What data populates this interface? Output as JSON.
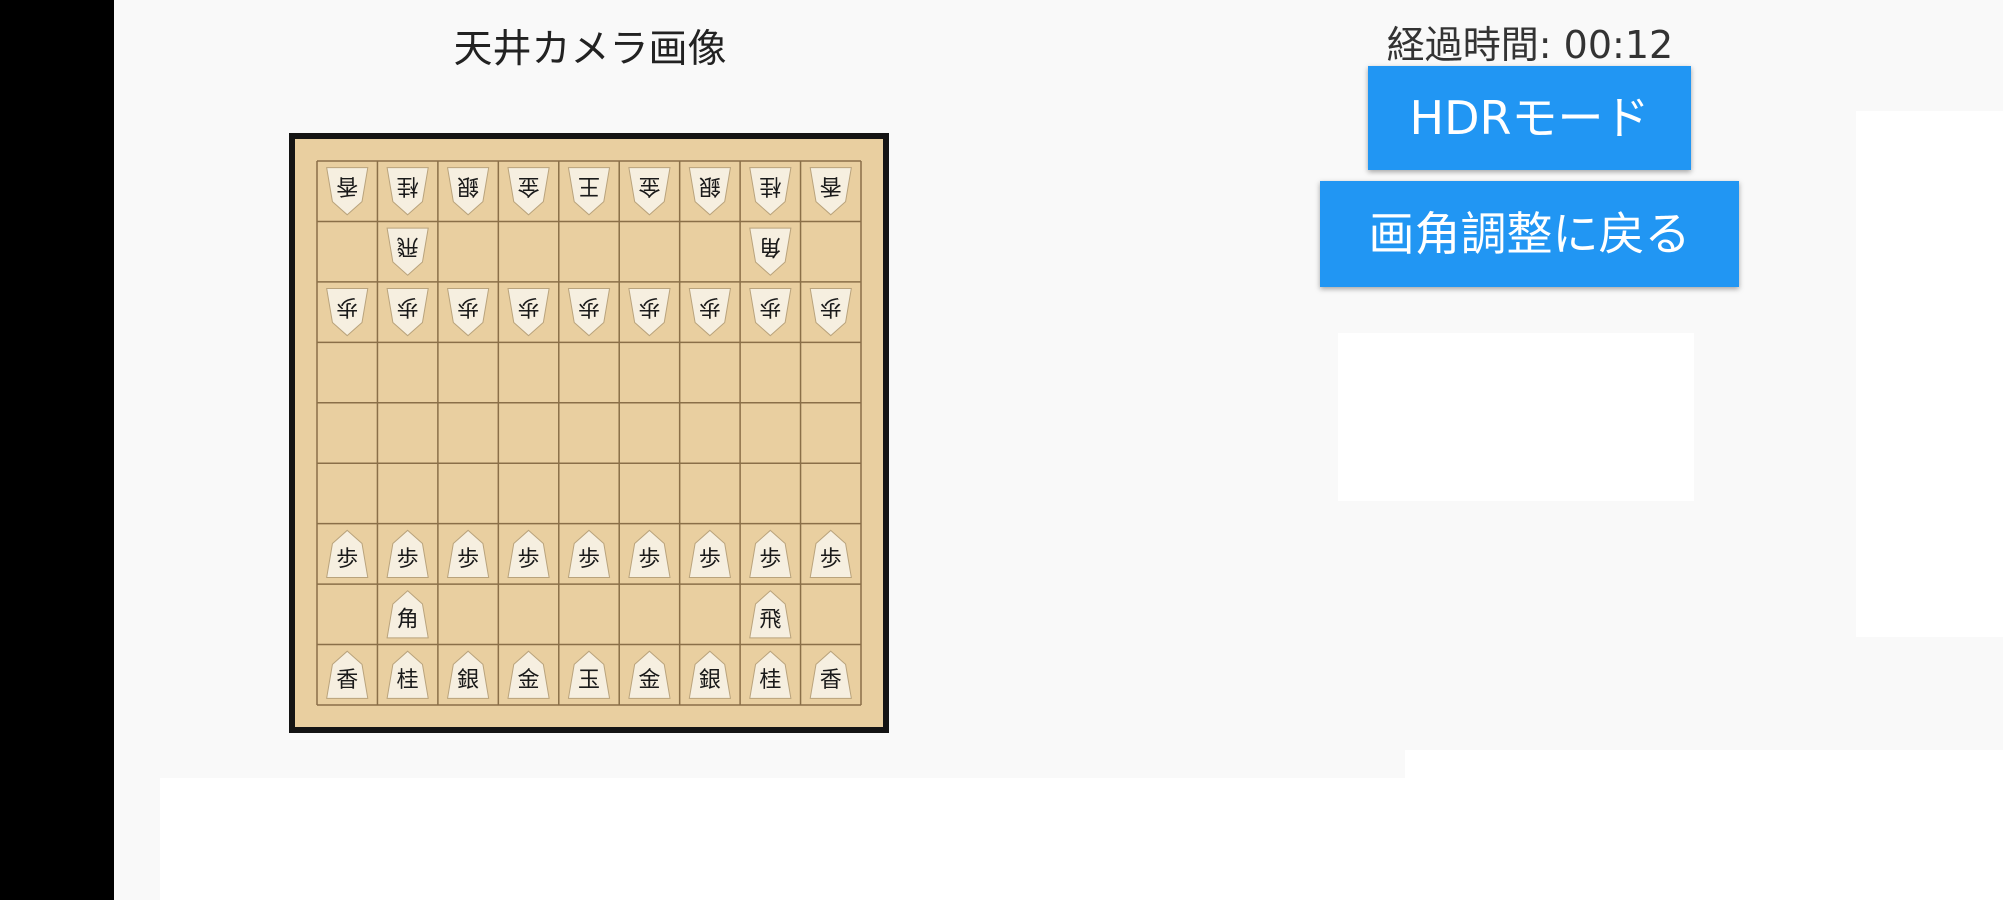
{
  "camera": {
    "title": "天井カメラ画像"
  },
  "timer": {
    "elapsed_label": "経過時間: 00:12"
  },
  "buttons": {
    "hdr_label": "HDRモード",
    "back_label": "画角調整に戻る"
  },
  "board": {
    "files": 9,
    "ranks": 9,
    "pieces": [
      {
        "rank": 1,
        "file": 1,
        "piece": "香",
        "side": "gote"
      },
      {
        "rank": 1,
        "file": 2,
        "piece": "桂",
        "side": "gote"
      },
      {
        "rank": 1,
        "file": 3,
        "piece": "銀",
        "side": "gote"
      },
      {
        "rank": 1,
        "file": 4,
        "piece": "金",
        "side": "gote"
      },
      {
        "rank": 1,
        "file": 5,
        "piece": "王",
        "side": "gote"
      },
      {
        "rank": 1,
        "file": 6,
        "piece": "金",
        "side": "gote"
      },
      {
        "rank": 1,
        "file": 7,
        "piece": "銀",
        "side": "gote"
      },
      {
        "rank": 1,
        "file": 8,
        "piece": "桂",
        "side": "gote"
      },
      {
        "rank": 1,
        "file": 9,
        "piece": "香",
        "side": "gote"
      },
      {
        "rank": 2,
        "file": 2,
        "piece": "飛",
        "side": "gote"
      },
      {
        "rank": 2,
        "file": 8,
        "piece": "角",
        "side": "gote"
      },
      {
        "rank": 3,
        "file": 1,
        "piece": "歩",
        "side": "gote"
      },
      {
        "rank": 3,
        "file": 2,
        "piece": "歩",
        "side": "gote"
      },
      {
        "rank": 3,
        "file": 3,
        "piece": "歩",
        "side": "gote"
      },
      {
        "rank": 3,
        "file": 4,
        "piece": "歩",
        "side": "gote"
      },
      {
        "rank": 3,
        "file": 5,
        "piece": "歩",
        "side": "gote"
      },
      {
        "rank": 3,
        "file": 6,
        "piece": "歩",
        "side": "gote"
      },
      {
        "rank": 3,
        "file": 7,
        "piece": "歩",
        "side": "gote"
      },
      {
        "rank": 3,
        "file": 8,
        "piece": "歩",
        "side": "gote"
      },
      {
        "rank": 3,
        "file": 9,
        "piece": "歩",
        "side": "gote"
      },
      {
        "rank": 7,
        "file": 1,
        "piece": "歩",
        "side": "sente"
      },
      {
        "rank": 7,
        "file": 2,
        "piece": "歩",
        "side": "sente"
      },
      {
        "rank": 7,
        "file": 3,
        "piece": "歩",
        "side": "sente"
      },
      {
        "rank": 7,
        "file": 4,
        "piece": "歩",
        "side": "sente"
      },
      {
        "rank": 7,
        "file": 5,
        "piece": "歩",
        "side": "sente"
      },
      {
        "rank": 7,
        "file": 6,
        "piece": "歩",
        "side": "sente"
      },
      {
        "rank": 7,
        "file": 7,
        "piece": "歩",
        "side": "sente"
      },
      {
        "rank": 7,
        "file": 8,
        "piece": "歩",
        "side": "sente"
      },
      {
        "rank": 7,
        "file": 9,
        "piece": "歩",
        "side": "sente"
      },
      {
        "rank": 8,
        "file": 2,
        "piece": "角",
        "side": "sente"
      },
      {
        "rank": 8,
        "file": 8,
        "piece": "飛",
        "side": "sente"
      },
      {
        "rank": 9,
        "file": 1,
        "piece": "香",
        "side": "sente"
      },
      {
        "rank": 9,
        "file": 2,
        "piece": "桂",
        "side": "sente"
      },
      {
        "rank": 9,
        "file": 3,
        "piece": "銀",
        "side": "sente"
      },
      {
        "rank": 9,
        "file": 4,
        "piece": "金",
        "side": "sente"
      },
      {
        "rank": 9,
        "file": 5,
        "piece": "玉",
        "side": "sente"
      },
      {
        "rank": 9,
        "file": 6,
        "piece": "金",
        "side": "sente"
      },
      {
        "rank": 9,
        "file": 7,
        "piece": "銀",
        "side": "sente"
      },
      {
        "rank": 9,
        "file": 8,
        "piece": "桂",
        "side": "sente"
      },
      {
        "rank": 9,
        "file": 9,
        "piece": "香",
        "side": "sente"
      }
    ]
  },
  "colors": {
    "accent": "#2196f3",
    "board_wood": "#e9cfa0",
    "board_line": "#8a6f48",
    "piece_face": "#f6efe0",
    "piece_ink": "#1a1a1a",
    "frame": "#141414"
  }
}
